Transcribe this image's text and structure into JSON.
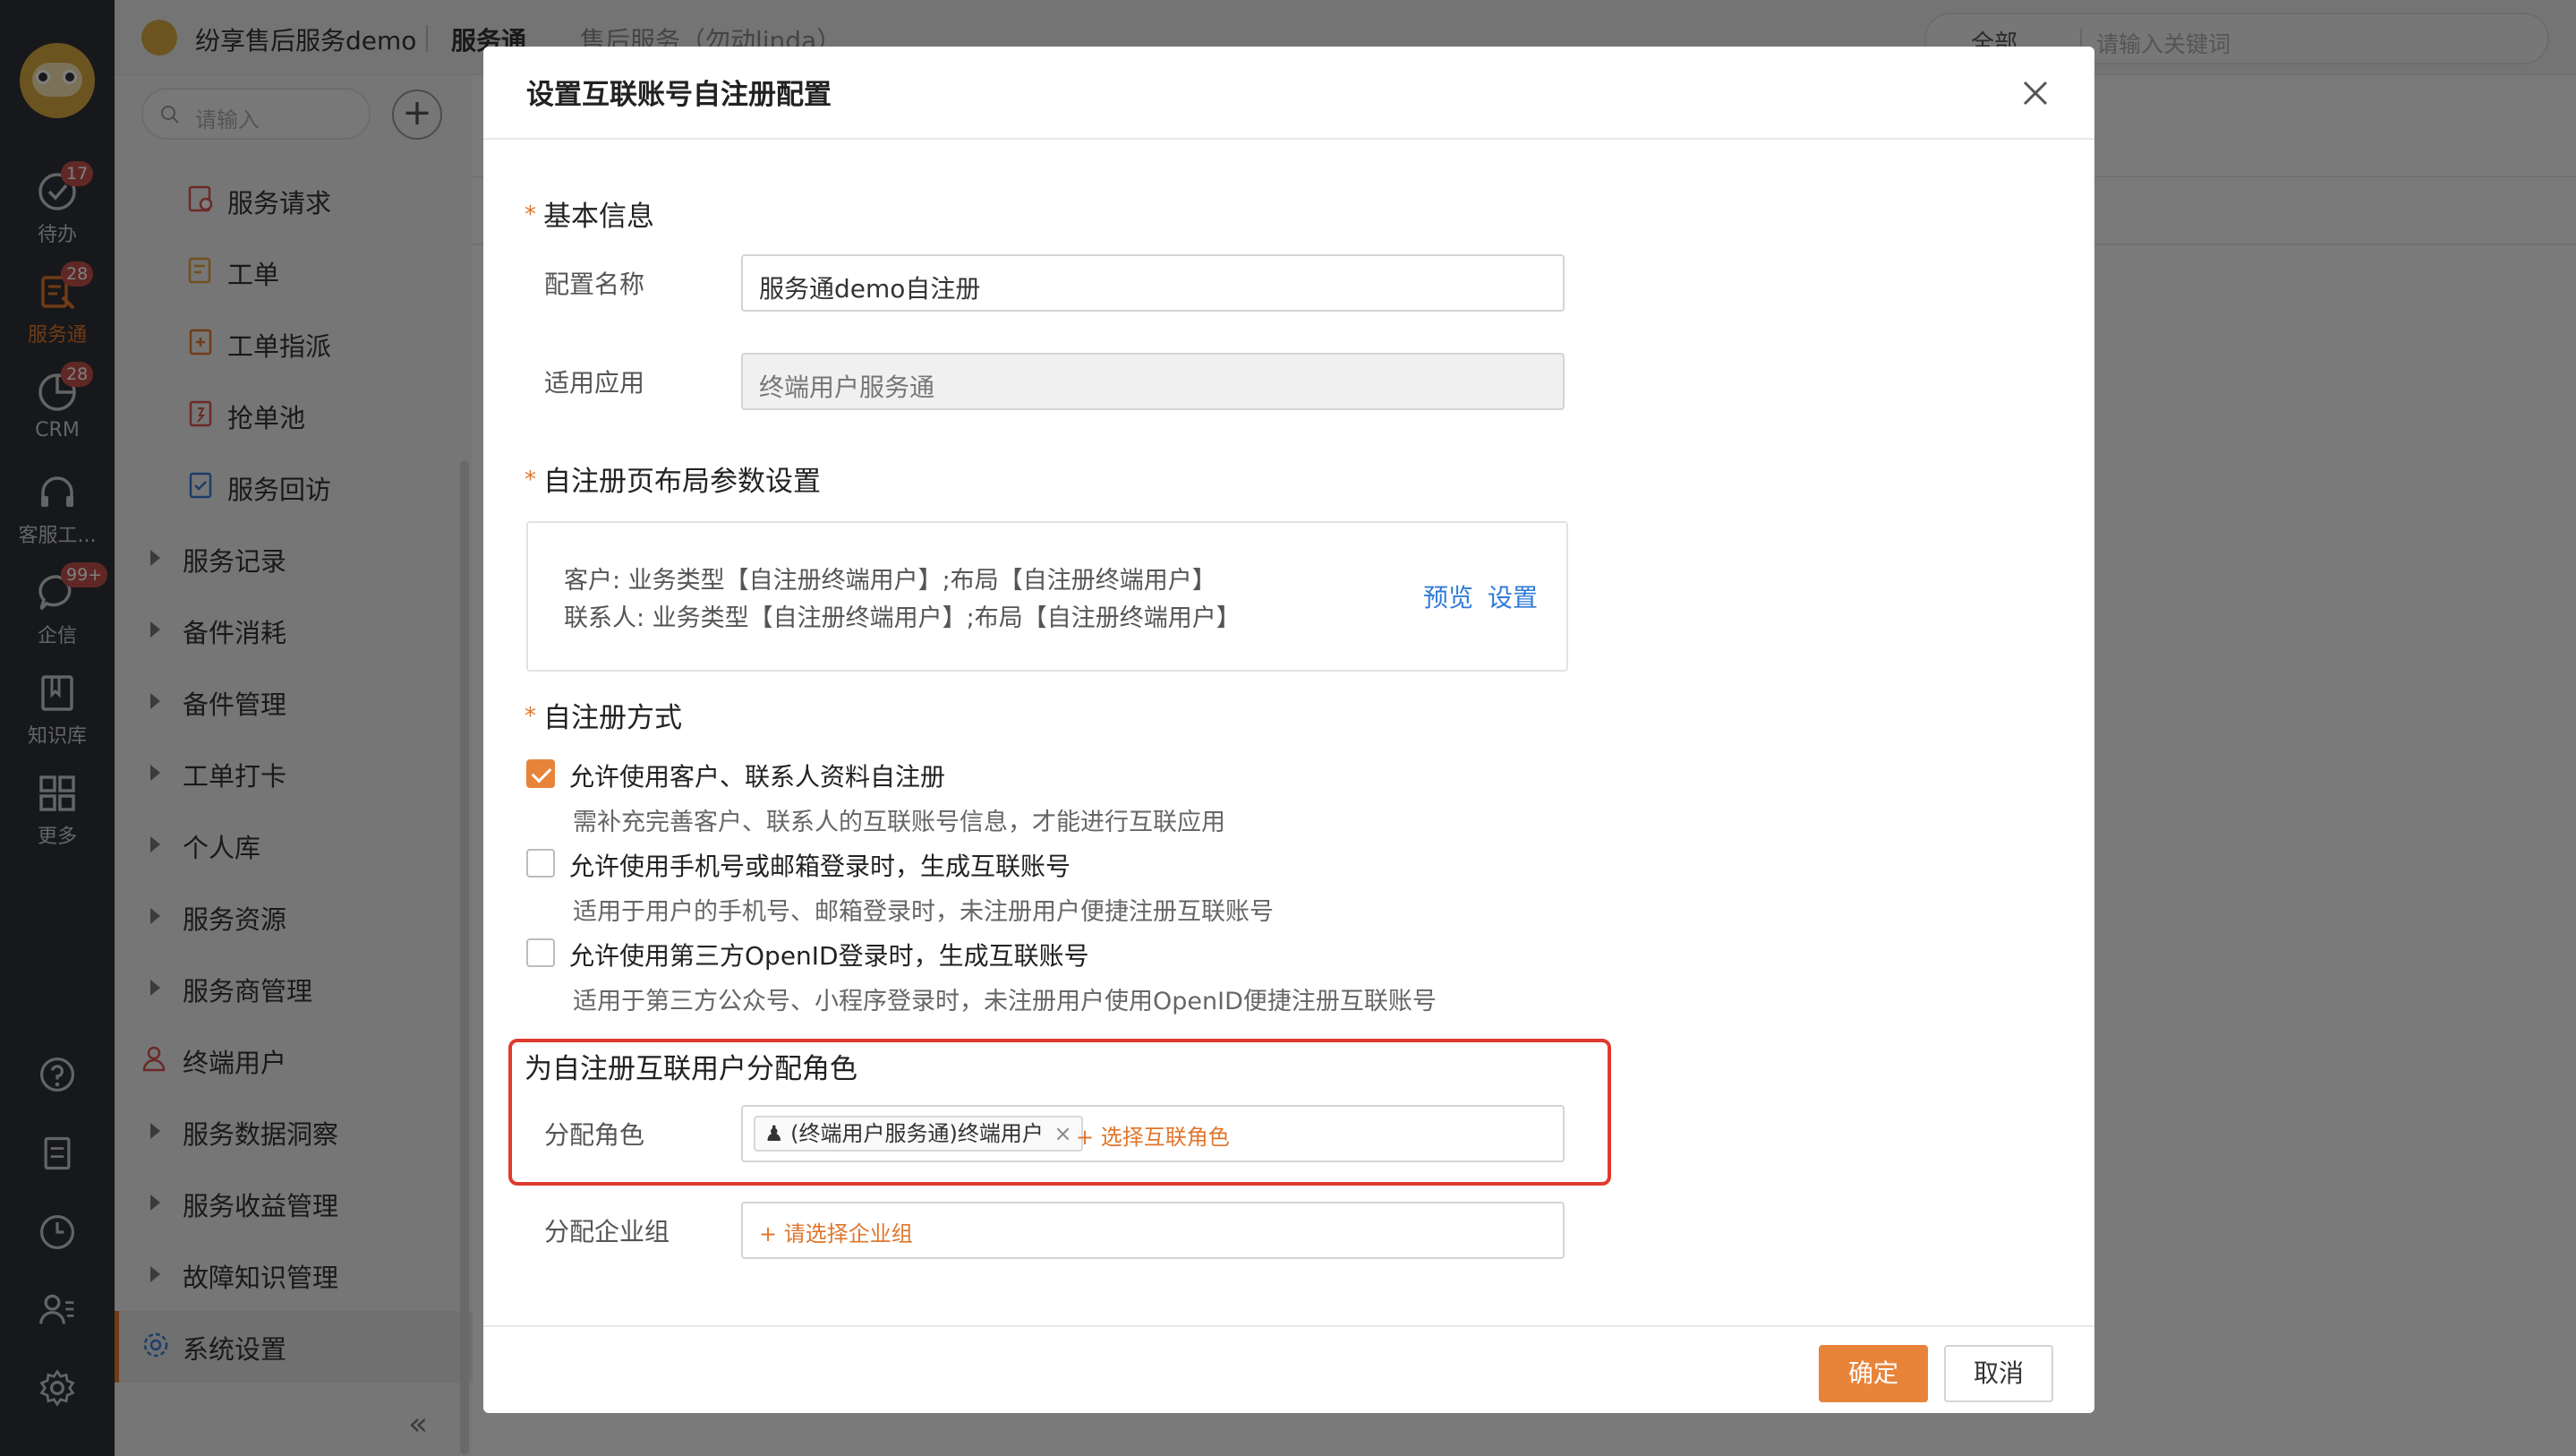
{
  "app": {
    "tenant": "纷享售后服务demo",
    "module": "服务通",
    "context": "售后服务（勿动linda）",
    "search_scope": "全部",
    "search_placeholder": "请输入关键词"
  },
  "rail": {
    "items": [
      {
        "label": "待办",
        "badge": "17",
        "icon": "todo-check-icon"
      },
      {
        "label": "服务通",
        "badge": "28",
        "icon": "service-tools-icon",
        "active": true
      },
      {
        "label": "CRM",
        "badge": "28",
        "icon": "crm-pie-icon"
      },
      {
        "label": "客服工...",
        "badge": "",
        "icon": "headset-icon"
      },
      {
        "label": "企信",
        "badge": "99+",
        "icon": "chat-bubble-icon"
      },
      {
        "label": "知识库",
        "badge": "",
        "icon": "book-icon"
      },
      {
        "label": "更多",
        "badge": "",
        "icon": "grid-icon"
      }
    ],
    "bottom_icons": [
      "help-icon",
      "notes-icon",
      "clock-icon",
      "contacts-icon",
      "settings-gear-icon"
    ]
  },
  "subnav": {
    "search_placeholder": "请输入",
    "items": [
      {
        "label": "服务请求",
        "type": "child",
        "icon": "service-request-icon"
      },
      {
        "label": "工单",
        "type": "child",
        "icon": "work-order-icon"
      },
      {
        "label": "工单指派",
        "type": "child",
        "icon": "dispatch-icon"
      },
      {
        "label": "抢单池",
        "type": "child",
        "icon": "grab-pool-icon"
      },
      {
        "label": "服务回访",
        "type": "child",
        "icon": "revisit-icon"
      },
      {
        "label": "服务记录",
        "type": "group"
      },
      {
        "label": "备件消耗",
        "type": "group"
      },
      {
        "label": "备件管理",
        "type": "group"
      },
      {
        "label": "工单打卡",
        "type": "group"
      },
      {
        "label": "个人库",
        "type": "group"
      },
      {
        "label": "服务资源",
        "type": "group"
      },
      {
        "label": "服务商管理",
        "type": "group"
      },
      {
        "label": "终端用户",
        "type": "leaf",
        "icon": "end-user-icon"
      },
      {
        "label": "服务数据洞察",
        "type": "group"
      },
      {
        "label": "服务收益管理",
        "type": "group"
      },
      {
        "label": "故障知识管理",
        "type": "group"
      },
      {
        "label": "系统设置",
        "type": "leaf",
        "icon": "system-settings-icon",
        "active": true
      }
    ]
  },
  "modal": {
    "title": "设置互联账号自注册配置",
    "sections": {
      "basic": "基本信息",
      "layout": "自注册页布局参数设置",
      "method": "自注册方式",
      "role": "为自注册互联用户分配角色"
    },
    "fields": {
      "config_name_label": "配置名称",
      "config_name_value": "服务通demo自注册",
      "app_label": "适用应用",
      "app_value": "终端用户服务通",
      "role_label": "分配角色",
      "role_tag": "(终端用户服务通)终端用户",
      "role_add": "+ 选择互联角色",
      "group_label": "分配企业组",
      "group_add": "+ 请选择企业组"
    },
    "layout_box": {
      "line1": "客户: 业务类型【自注册终端用户】;布局【自注册终端用户】",
      "line2": "联系人: 业务类型【自注册终端用户】;布局【自注册终端用户】",
      "preview": "预览",
      "settings": "设置"
    },
    "options": [
      {
        "label": "允许使用客户、联系人资料自注册",
        "desc": "需补充完善客户、联系人的互联账号信息，才能进行互联应用",
        "checked": true
      },
      {
        "label": "允许使用手机号或邮箱登录时，生成互联账号",
        "desc": "适用于用户的手机号、邮箱登录时，未注册用户便捷注册互联账号",
        "checked": false
      },
      {
        "label": "允许使用第三方OpenID登录时，生成互联账号",
        "desc": "适用于第三方公众号、小程序登录时，未注册用户使用OpenID便捷注册互联账号",
        "checked": false
      }
    ],
    "buttons": {
      "confirm": "确定",
      "cancel": "取消"
    }
  },
  "colors": {
    "accent": "#e8843a",
    "link": "#2f7ad8",
    "highlight": "#e03a2e",
    "rail": "#2f3136"
  }
}
